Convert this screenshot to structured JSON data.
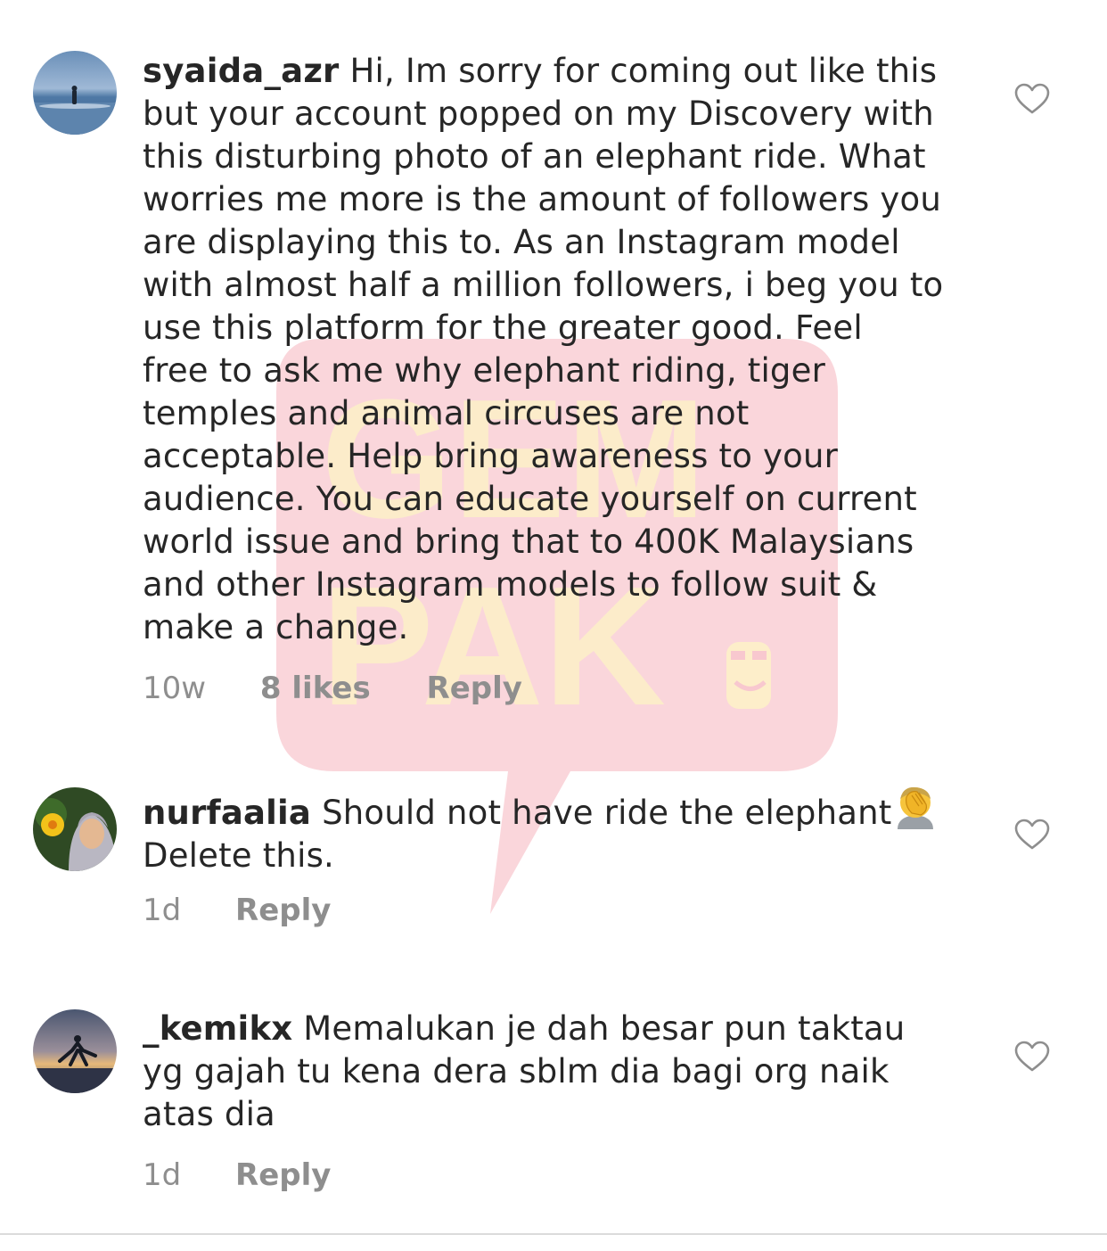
{
  "colors": {
    "text": "#262626",
    "secondary": "#8e8e8e",
    "watermark_pink": "#f8c8cf",
    "watermark_yellow": "#fdf1c8"
  },
  "watermark": {
    "line1": "GEM",
    "line2": "PAK"
  },
  "comments": [
    {
      "username": "syaida_azr",
      "text_lines": [
        "Hi, Im sorry for coming out like this",
        "but your account popped on my Discovery with",
        "this disturbing photo of an elephant ride. What",
        "worries me more is the amount of followers you",
        "are displaying this to. As an Instagram model",
        "with almost half a million followers, i beg you to",
        "use this platform for the greater good. Feel",
        "free to ask me why elephant riding, tiger",
        "temples and animal circuses are not",
        "acceptable. Help bring awareness to your",
        "audience. You can educate yourself on current",
        "world issue and bring that to 400K Malaysians",
        "and other Instagram models to follow suit &",
        "make a change."
      ],
      "time": "10w",
      "likes": "8 likes",
      "reply": "Reply",
      "avatar_icon": "beach-photo-avatar",
      "like_icon": "heart-outline-icon"
    },
    {
      "username": "nurfaalia",
      "text_lines": [
        "Should not have ride the elephant",
        "Delete this."
      ],
      "emoji": "face-palm-emoji",
      "time": "1d",
      "reply": "Reply",
      "avatar_icon": "hijab-portrait-avatar",
      "like_icon": "heart-outline-icon"
    },
    {
      "username": "_kemikx",
      "text_lines": [
        "Memalukan je dah besar pun taktau",
        "yg gajah tu kena dera sblm dia bagi org naik",
        "atas dia"
      ],
      "time": "1d",
      "reply": "Reply",
      "avatar_icon": "sunset-jump-avatar",
      "like_icon": "heart-outline-icon"
    }
  ]
}
